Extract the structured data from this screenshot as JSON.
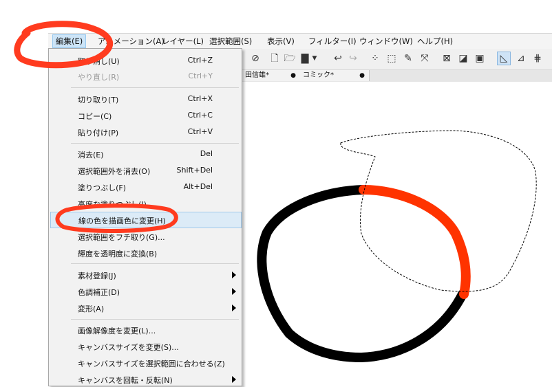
{
  "menubar": {
    "items": [
      "編集(E)",
      "アニメーション(A)",
      "レイヤー(L)",
      "選択範囲(S)",
      "表示(V)",
      "フィルター(I)",
      "ウィンドウ(W)",
      "ヘルプ(H)"
    ]
  },
  "tabs": [
    {
      "label": "田信雄*",
      "close": "●"
    },
    {
      "label": "コミック*",
      "close": "●"
    }
  ],
  "menu": {
    "items": [
      {
        "label": "取り消し(U)",
        "shortcut": "Ctrl+Z",
        "disabled": false
      },
      {
        "label": "やり直し(R)",
        "shortcut": "Ctrl+Y",
        "disabled": true
      },
      {
        "label": "切り取り(T)",
        "shortcut": "Ctrl+X"
      },
      {
        "label": "コピー(C)",
        "shortcut": "Ctrl+C"
      },
      {
        "label": "貼り付け(P)",
        "shortcut": "Ctrl+V"
      },
      {
        "label": "消去(E)",
        "shortcut": "Del"
      },
      {
        "label": "選択範囲外を消去(O)",
        "shortcut": "Shift+Del"
      },
      {
        "label": "塗りつぶし(F)",
        "shortcut": "Alt+Del"
      },
      {
        "label": "高度な塗りつぶし(I)...",
        "shortcut": ""
      },
      {
        "label": "線の色を描画色に変更(H)",
        "shortcut": "",
        "highlighted": true
      },
      {
        "label": "選択範囲をフチ取り(G)...",
        "shortcut": ""
      },
      {
        "label": "輝度を透明度に変換(B)",
        "shortcut": ""
      },
      {
        "label": "素材登録(J)",
        "submenu": true
      },
      {
        "label": "色調補正(D)",
        "submenu": true
      },
      {
        "label": "変形(A)",
        "submenu": true
      },
      {
        "label": "画像解像度を変更(L)...",
        "shortcut": ""
      },
      {
        "label": "キャンバスサイズを変更(S)...",
        "shortcut": ""
      },
      {
        "label": "キャンバスサイズを選択範囲に合わせる(Z)",
        "shortcut": ""
      },
      {
        "label": "キャンバスを回転・反転(N)",
        "submenu": true
      }
    ]
  },
  "colors": {
    "annotation": "#ff3b1f",
    "stroke_black": "#000000",
    "stroke_red": "#ff3300",
    "highlight": "#dcebf7"
  },
  "toolbar_icons": [
    "lasso-icon",
    "new-file-icon",
    "open-folder-icon",
    "save-icon",
    "dropdown-arrow-icon",
    "undo-icon",
    "redo-icon",
    "selection-dots-icon",
    "transform-icon",
    "brush-icon",
    "scale-icon",
    "deselect-icon",
    "invert-icon",
    "frame-icon",
    "ruler-icon",
    "ruler-corner-icon",
    "grid-icon"
  ]
}
